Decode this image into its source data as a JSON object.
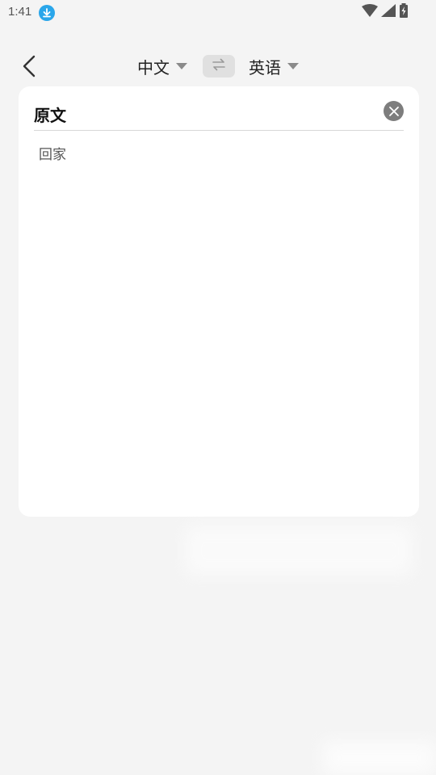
{
  "status_bar": {
    "time": "1:41",
    "icons": [
      "download-icon",
      "wifi-icon",
      "signal-icon",
      "battery-icon"
    ]
  },
  "nav": {
    "back_icon": "chevron-left-icon",
    "source_language": "中文",
    "target_language": "英语",
    "swap_icon": "swap-arrows-icon"
  },
  "card": {
    "title": "原文",
    "clear_icon": "close-circle-icon",
    "source_text": "回家"
  },
  "colors": {
    "background": "#f4f4f4",
    "card": "#ffffff",
    "accent_download": "#2aa6ea",
    "clear_button": "#7d7d7d",
    "swap_button": "#e0e0e0"
  }
}
